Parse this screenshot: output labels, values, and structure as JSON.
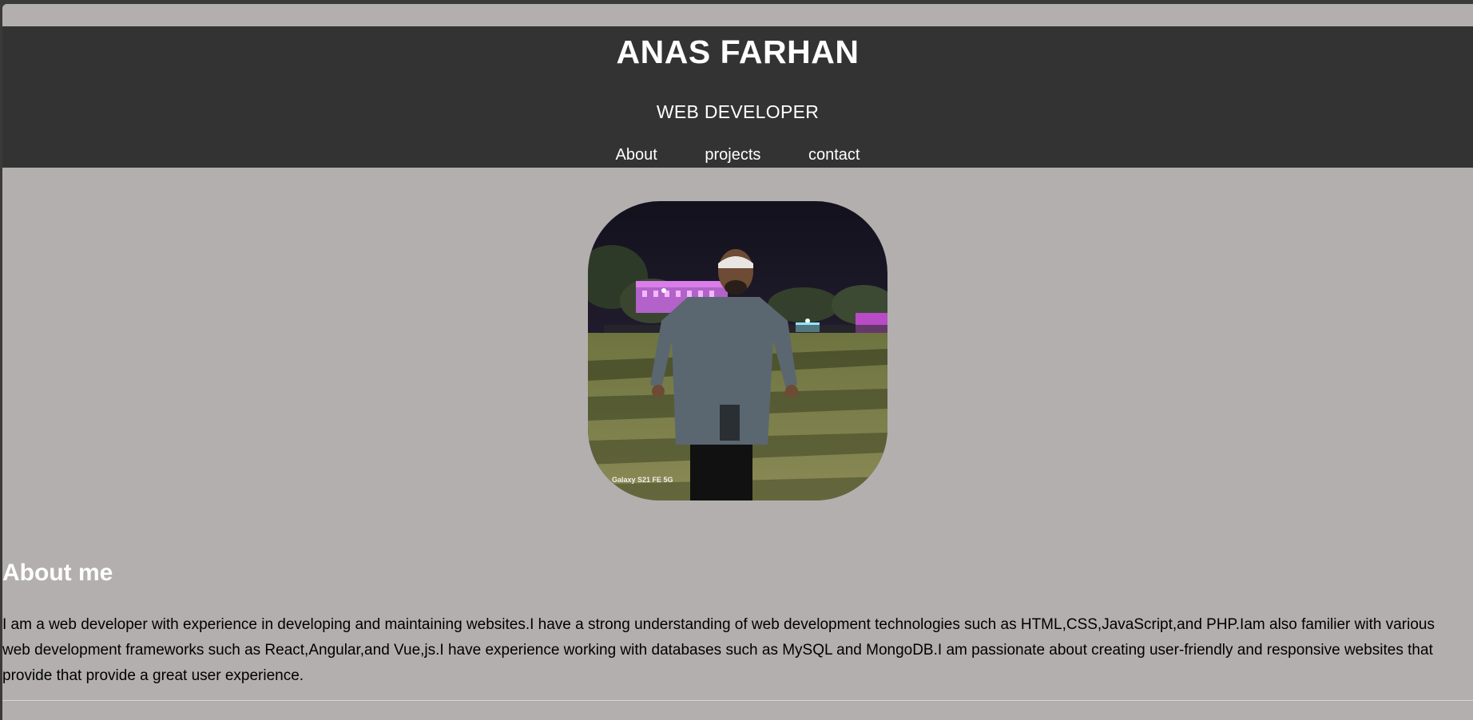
{
  "header": {
    "name": "ANAS FARHAN",
    "role": "WEB DEVELOPER"
  },
  "nav": {
    "items": [
      {
        "label": "About"
      },
      {
        "label": "projects"
      },
      {
        "label": "contact"
      }
    ]
  },
  "profile": {
    "photo_icon": "profile-photo",
    "photo_watermark": "Galaxy S21 FE 5G"
  },
  "about": {
    "title": "About me",
    "text": "I am a web developer with experience in developing and maintaining websites.I have a strong understanding of web development technologies such as HTML,CSS,JavaScript,and PHP.Iam also familier with various web development frameworks such as React,Angular,and Vue,js.I have experience working with databases such as MySQL and MongoDB.I am passionate about creating user-friendly and responsive websites that provide that provide a great user experience."
  },
  "colors": {
    "header_bg": "#333333",
    "page_bg": "#b3afae",
    "header_text": "#ffffff"
  }
}
